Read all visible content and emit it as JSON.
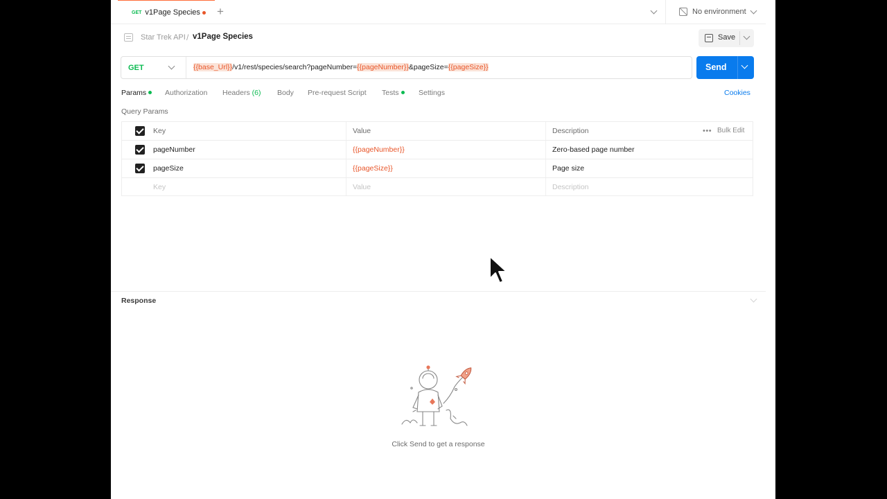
{
  "tab": {
    "method": "GET",
    "title": "v1Page Species"
  },
  "environment": {
    "label": "No environment"
  },
  "breadcrumb": {
    "parent": "Star Trek API",
    "separator": "/",
    "current": "v1Page Species"
  },
  "toolbar": {
    "save_label": "Save"
  },
  "request": {
    "method": "GET",
    "url_parts": {
      "base_var": "{{base_Url}}",
      "path": "/v1/rest/species/search?pageNumber=",
      "page_number_var": "{{pageNumber}}",
      "middle": "&pageSize=",
      "page_size_var": "{{pageSize}}"
    },
    "send_label": "Send"
  },
  "request_tabs": [
    {
      "label": "Params",
      "active": true,
      "dot": true
    },
    {
      "label": "Authorization"
    },
    {
      "label": "Headers",
      "count": "(6)"
    },
    {
      "label": "Body"
    },
    {
      "label": "Pre-request Script"
    },
    {
      "label": "Tests",
      "dot": true
    },
    {
      "label": "Settings"
    }
  ],
  "cookies_label": "Cookies",
  "query_params": {
    "title": "Query Params",
    "headers": {
      "key": "Key",
      "value": "Value",
      "description": "Description",
      "bulk_edit": "Bulk Edit"
    },
    "rows": [
      {
        "key": "pageNumber",
        "value": "{{pageNumber}}",
        "description": "Zero-based page number",
        "checked": true
      },
      {
        "key": "pageSize",
        "value": "{{pageSize}}",
        "description": "Page size",
        "checked": true
      }
    ],
    "placeholder": {
      "key": "Key",
      "value": "Value",
      "description": "Description"
    }
  },
  "response": {
    "title": "Response",
    "hint": "Click Send to get a response"
  },
  "colors": {
    "accent_orange": "#ff6c37",
    "variable": "#e8562a",
    "send_blue": "#097bed",
    "method_green": "#0cbb52"
  },
  "icons": [
    "plus-icon",
    "chevron-down-icon",
    "no-environment-icon",
    "collection-icon",
    "save-icon",
    "more-icon",
    "astronaut-illustration",
    "mouse-cursor"
  ]
}
